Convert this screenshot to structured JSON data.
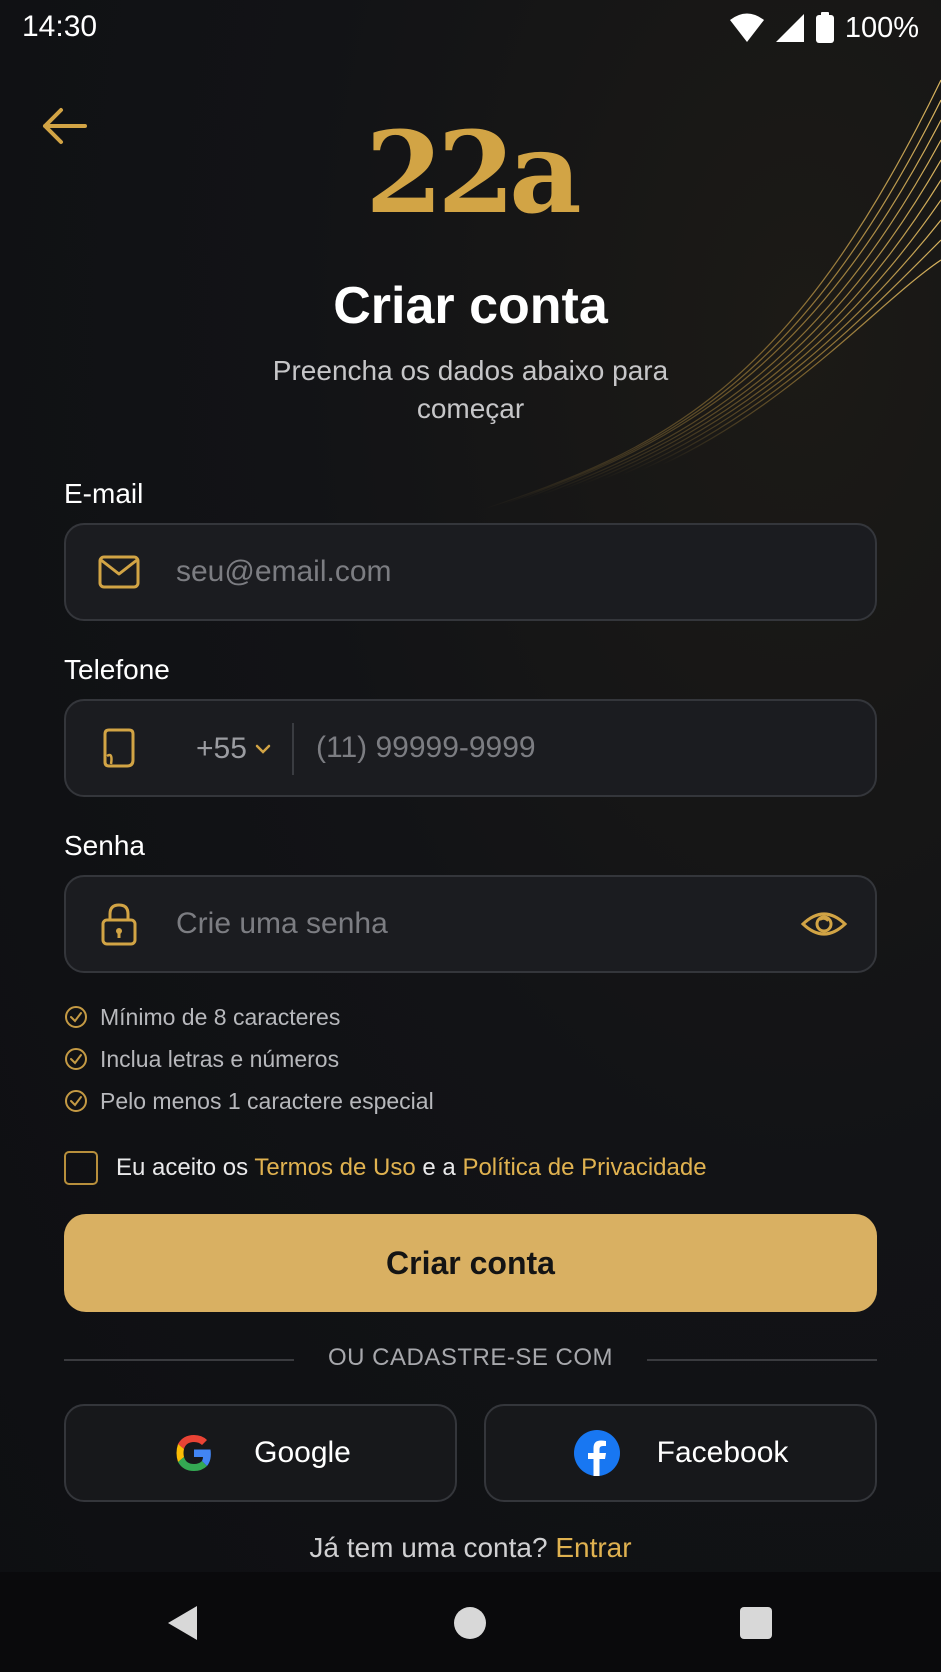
{
  "status_bar": {
    "time": "14:30",
    "battery": "100%"
  },
  "header": {
    "logo": "22a",
    "title": "Criar conta",
    "subtitle": "Preencha os dados abaixo para começar"
  },
  "form": {
    "email": {
      "label": "E-mail",
      "placeholder": "seu@email.com",
      "icon": "mail-icon"
    },
    "phone": {
      "label": "Telefone",
      "country_code": "+55",
      "placeholder": "(11) 99999-9999",
      "icon": "phone-icon"
    },
    "password": {
      "label": "Senha",
      "placeholder": "Crie uma senha",
      "icon": "lock-icon"
    },
    "requirements": [
      "Mínimo de 8 caracteres",
      "Inclua letras e números",
      "Pelo menos 1 caractere especial"
    ],
    "terms": {
      "prefix": "Eu aceito os",
      "terms_link": "Termos de Uso",
      "middle": "e a",
      "privacy_link": "Política de Privacidade"
    },
    "submit_label": "Criar conta"
  },
  "social": {
    "divider": "OU CADASTRE-SE COM",
    "google_label": "Google",
    "facebook_label": "Facebook"
  },
  "footer": {
    "prompt": "Já tem uma conta?",
    "signin_link": "Entrar"
  },
  "colors": {
    "accent": "#d9b062",
    "gold": "#d2a445",
    "background": "#0f1013",
    "field": "#1b1c20"
  }
}
